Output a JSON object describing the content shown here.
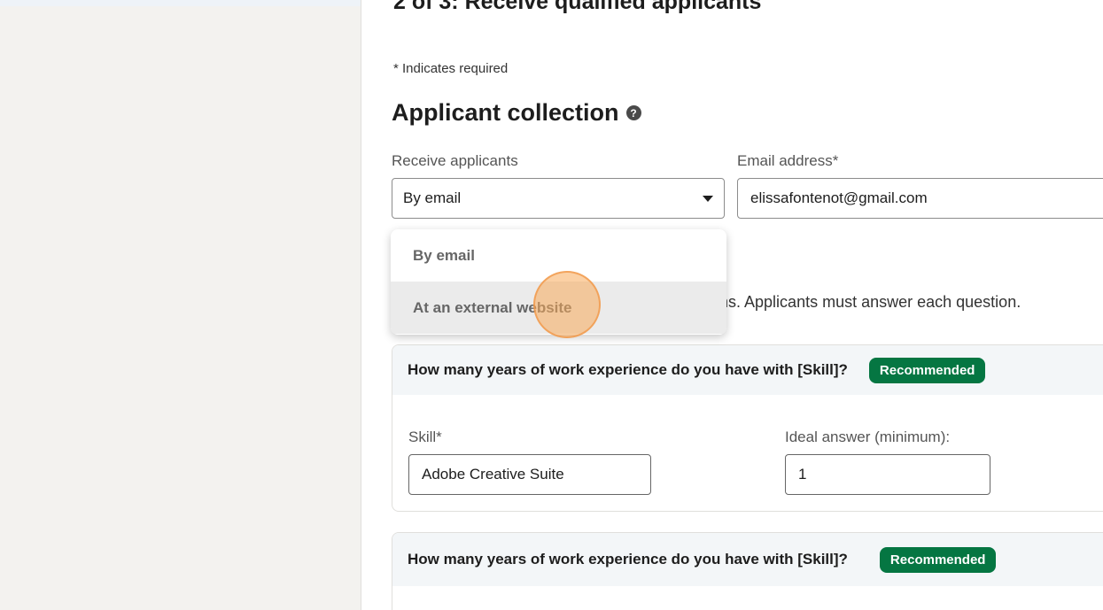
{
  "form": {
    "step_title": "2 of 3: Receive qualified applicants",
    "required_note": "* Indicates required",
    "section_title": "Applicant collection",
    "receive_label": "Receive applicants",
    "receive_value": "By email",
    "email_label": "Email address*",
    "email_value": "elissafontenot@gmail.com",
    "questions_desc": "ions. Applicants must answer each question."
  },
  "dropdown": {
    "options": [
      "By email",
      "At an external website"
    ],
    "hovered": "At an external website"
  },
  "questions": [
    {
      "title": "How many years of work experience do you have with [Skill]?",
      "badge": "Recommended",
      "skill_label": "Skill*",
      "skill_value": "Adobe Creative Suite",
      "answer_label": "Ideal answer (minimum):",
      "answer_value": "1"
    },
    {
      "title": "How many years of work experience do you have with [Skill]?",
      "badge": "Recommended"
    }
  ],
  "colors": {
    "badge_green": "#057642",
    "page_background": "#f3f2ef",
    "cursor_highlight": "#f8aa5a"
  },
  "icons": {
    "help": "help-circle-icon",
    "select_caret": "caret-down-icon"
  }
}
